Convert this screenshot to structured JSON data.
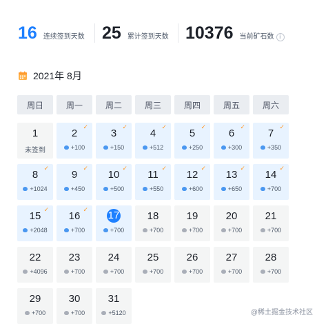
{
  "stats": {
    "consecutive": {
      "value": "16",
      "label": "连续签到天数"
    },
    "total": {
      "value": "25",
      "label": "累计签到天数"
    },
    "ore": {
      "value": "10376",
      "label": "当前矿石数"
    }
  },
  "month": {
    "title": "2021年 8月"
  },
  "weekdays": [
    "周日",
    "周一",
    "周二",
    "周三",
    "周四",
    "周五",
    "周六"
  ],
  "days": [
    {
      "day": "1",
      "text": "未签到",
      "status": "missed"
    },
    {
      "day": "2",
      "reward": "+100",
      "status": "checked"
    },
    {
      "day": "3",
      "reward": "+150",
      "status": "checked"
    },
    {
      "day": "4",
      "reward": "+512",
      "status": "checked"
    },
    {
      "day": "5",
      "reward": "+250",
      "status": "checked"
    },
    {
      "day": "6",
      "reward": "+300",
      "status": "checked"
    },
    {
      "day": "7",
      "reward": "+350",
      "status": "checked"
    },
    {
      "day": "8",
      "reward": "+1024",
      "status": "checked"
    },
    {
      "day": "9",
      "reward": "+450",
      "status": "checked"
    },
    {
      "day": "10",
      "reward": "+500",
      "status": "checked"
    },
    {
      "day": "11",
      "reward": "+550",
      "status": "checked"
    },
    {
      "day": "12",
      "reward": "+600",
      "status": "checked"
    },
    {
      "day": "13",
      "reward": "+650",
      "status": "checked"
    },
    {
      "day": "14",
      "reward": "+700",
      "status": "checked"
    },
    {
      "day": "15",
      "reward": "+2048",
      "status": "checked"
    },
    {
      "day": "16",
      "reward": "+700",
      "status": "checked"
    },
    {
      "day": "17",
      "reward": "+700",
      "status": "today"
    },
    {
      "day": "18",
      "reward": "+700",
      "status": "future"
    },
    {
      "day": "19",
      "reward": "+700",
      "status": "future"
    },
    {
      "day": "20",
      "reward": "+700",
      "status": "future"
    },
    {
      "day": "21",
      "reward": "+700",
      "status": "future"
    },
    {
      "day": "22",
      "reward": "+4096",
      "status": "future"
    },
    {
      "day": "23",
      "reward": "+700",
      "status": "future"
    },
    {
      "day": "24",
      "reward": "+700",
      "status": "future"
    },
    {
      "day": "25",
      "reward": "+700",
      "status": "future"
    },
    {
      "day": "26",
      "reward": "+700",
      "status": "future"
    },
    {
      "day": "27",
      "reward": "+700",
      "status": "future"
    },
    {
      "day": "28",
      "reward": "+700",
      "status": "future"
    },
    {
      "day": "29",
      "reward": "+700",
      "status": "future"
    },
    {
      "day": "30",
      "reward": "+700",
      "status": "future"
    },
    {
      "day": "31",
      "reward": "+5120",
      "status": "future"
    }
  ],
  "check_mark": "✓",
  "watermark": "@稀土掘金技术社区",
  "colors": {
    "accent": "#1e80ff",
    "check": "#ff9a2e",
    "checked_bg": "#e8f3ff",
    "cell_bg": "#f4f5f5"
  }
}
